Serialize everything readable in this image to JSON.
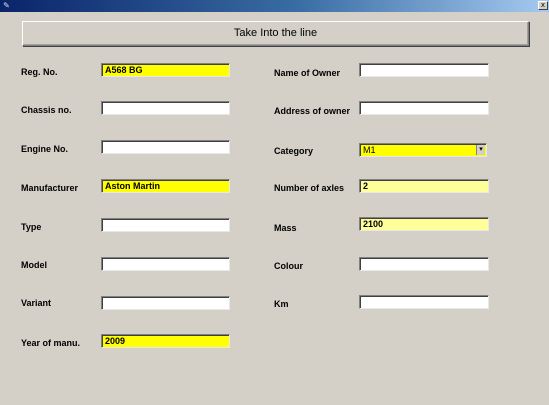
{
  "window": {
    "icon": "app-icon",
    "close_glyph": "x"
  },
  "header": {
    "button_label": "Take Into the line"
  },
  "form": {
    "reg_no": {
      "label": "Reg. No.",
      "value": "A568 BG"
    },
    "chassis_no": {
      "label": "Chassis no.",
      "value": ""
    },
    "engine_no": {
      "label": "Engine No.",
      "value": ""
    },
    "manufacturer": {
      "label": "Manufacturer",
      "value": "Aston Martin"
    },
    "type": {
      "label": "Type",
      "value": ""
    },
    "model": {
      "label": "Model",
      "value": ""
    },
    "variant": {
      "label": "Variant",
      "value": ""
    },
    "year_of_manu": {
      "label": "Year of manu.",
      "value": "2009"
    },
    "name_of_owner": {
      "label": "Name of Owner",
      "value": ""
    },
    "address_of_owner": {
      "label": "Address of owner",
      "value": ""
    },
    "category": {
      "label": "Category",
      "value": "M1"
    },
    "number_of_axles": {
      "label": "Number of axles",
      "value": "2"
    },
    "mass": {
      "label": "Mass",
      "value": "2100"
    },
    "colour": {
      "label": "Colour",
      "value": ""
    },
    "km": {
      "label": "Km",
      "value": ""
    }
  },
  "colors": {
    "highlight": "#ffff00",
    "highlight_pale": "#ffff99",
    "background": "#d4d0c8",
    "titlebar": "#0a246a"
  }
}
